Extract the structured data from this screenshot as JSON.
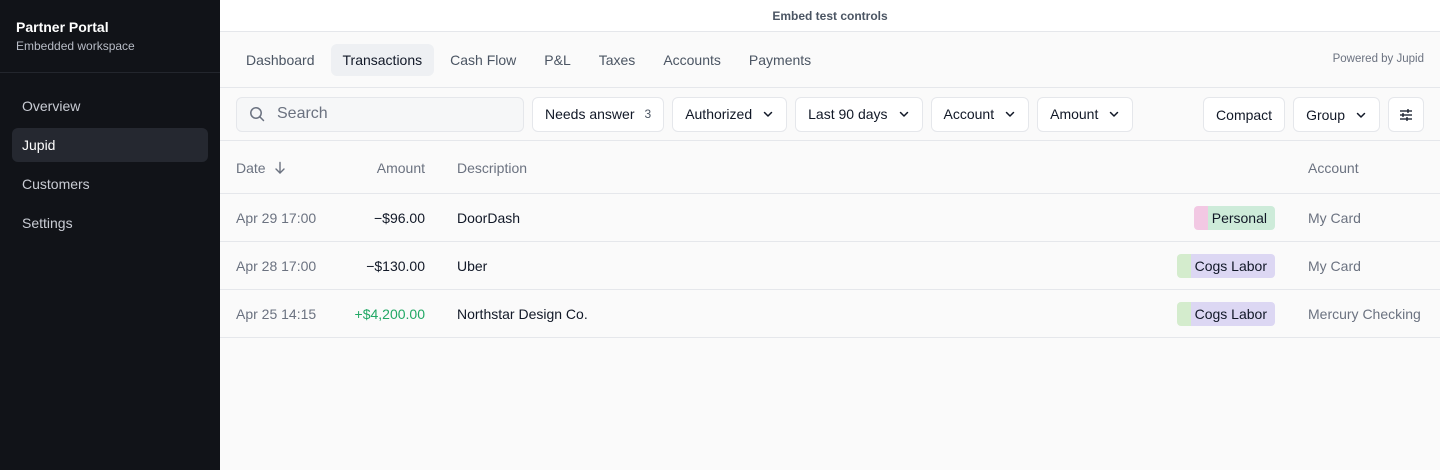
{
  "sidebar": {
    "title": "Partner Portal",
    "subtitle": "Embedded workspace",
    "items": [
      {
        "label": "Overview",
        "active": false
      },
      {
        "label": "Jupid",
        "active": true
      },
      {
        "label": "Customers",
        "active": false
      },
      {
        "label": "Settings",
        "active": false
      }
    ]
  },
  "embed_bar": {
    "label": "Embed test controls"
  },
  "tabs": [
    {
      "label": "Dashboard"
    },
    {
      "label": "Transactions"
    },
    {
      "label": "Cash Flow"
    },
    {
      "label": "P&L"
    },
    {
      "label": "Taxes"
    },
    {
      "label": "Accounts"
    },
    {
      "label": "Payments"
    }
  ],
  "powered_by": "Powered by Jupid",
  "filters": {
    "search_placeholder": "Search",
    "needs_answer_label": "Needs answer",
    "needs_answer_count": "3",
    "status": "Authorized",
    "date_range": "Last 90 days",
    "account": "Account",
    "amount": "Amount",
    "compact": "Compact",
    "group": "Group"
  },
  "table": {
    "headers": {
      "date": "Date",
      "amount": "Amount",
      "description": "Description",
      "account": "Account"
    },
    "rows": [
      {
        "date": "Apr 29 17:00",
        "amount": "−$96.00",
        "description": "DoorDash",
        "category": "Personal",
        "account": "My Card"
      },
      {
        "date": "Apr 28 17:00",
        "amount": "−$130.00",
        "description": "Uber",
        "category": "Cogs Labor",
        "account": "My Card"
      },
      {
        "date": "Apr 25 14:15",
        "amount": "+$4,200.00",
        "description": "Northstar Design Co.",
        "category": "Cogs Labor",
        "account": "Mercury Checking"
      }
    ]
  },
  "colors": {
    "sidebar_bg": "#111318",
    "positive_amount": "#22a865",
    "personal_tag": "#cdebd9",
    "cogs_tag": "#dcd7f3"
  }
}
